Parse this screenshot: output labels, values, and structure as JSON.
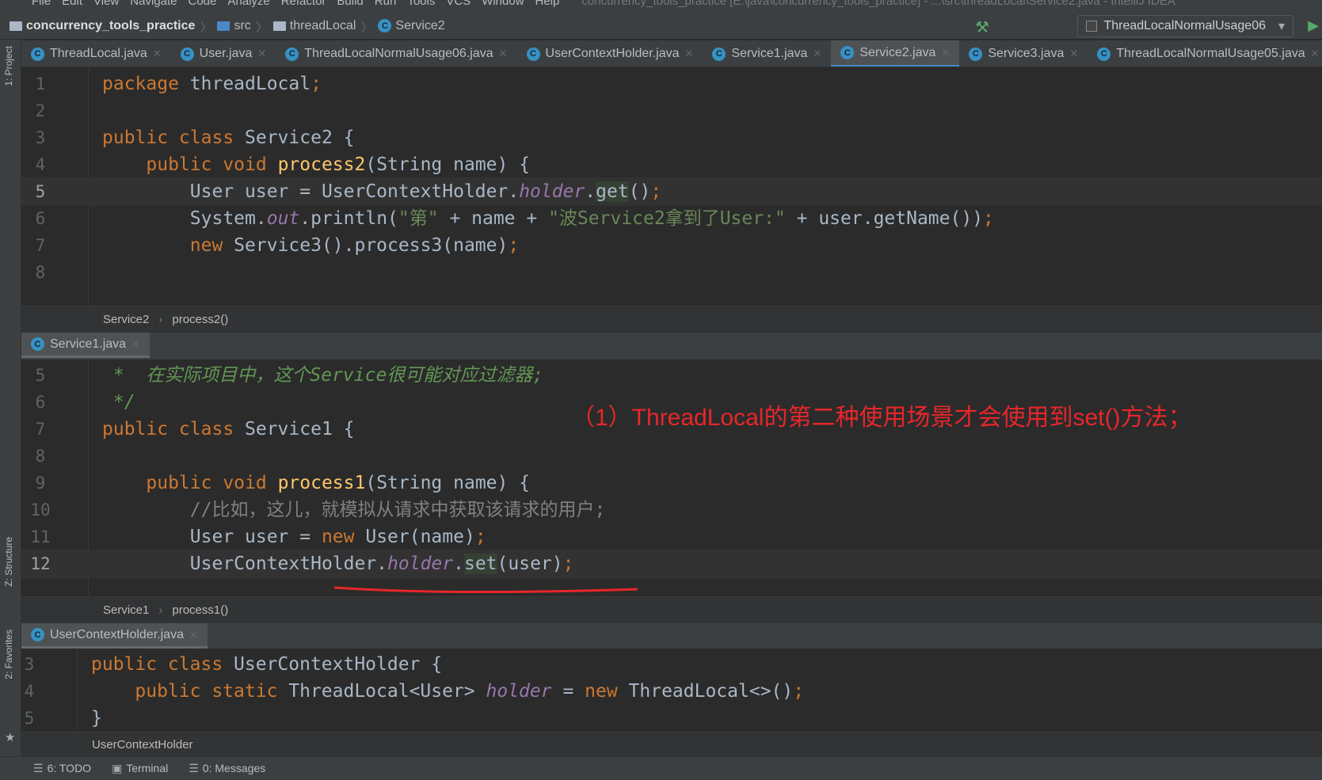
{
  "menu": {
    "items": [
      "File",
      "Edit",
      "View",
      "Navigate",
      "Code",
      "Analyze",
      "Refactor",
      "Build",
      "Run",
      "Tools",
      "VCS",
      "Window",
      "Help"
    ],
    "title": "concurrency_tools_practice [E:\\java\\concurrency_tools_practice] - ...\\src\\threadLocal\\Service2.java - IntelliJ IDEA"
  },
  "breadcrumb": {
    "project": "concurrency_tools_practice",
    "src": "src",
    "package": "threadLocal",
    "file": "Service2"
  },
  "run_config": "ThreadLocalNormalUsage06",
  "side": {
    "project": "1: Project",
    "structure": "Z: Structure",
    "favorites": "2: Favorites"
  },
  "tabs": [
    {
      "label": "ThreadLocal.java"
    },
    {
      "label": "User.java"
    },
    {
      "label": "ThreadLocalNormalUsage06.java"
    },
    {
      "label": "UserContextHolder.java"
    },
    {
      "label": "Service1.java"
    },
    {
      "label": "Service2.java",
      "active": true
    },
    {
      "label": "Service3.java"
    },
    {
      "label": "ThreadLocalNormalUsage05.java"
    }
  ],
  "editor1": {
    "current": 5,
    "lines": [
      {
        "n": "1",
        "t": [
          [
            "package",
            "kw"
          ],
          [
            " threadLocal",
            ""
          ],
          [
            ";",
            "kw"
          ]
        ]
      },
      {
        "n": "2",
        "t": []
      },
      {
        "n": "3",
        "t": [
          [
            "public class",
            "kw"
          ],
          [
            " Service2 {",
            ""
          ]
        ]
      },
      {
        "n": "4",
        "t": [
          [
            "    public void ",
            "kw"
          ],
          [
            "process2",
            "fn"
          ],
          [
            "(String name) {",
            ""
          ]
        ]
      },
      {
        "n": "5",
        "t": [
          [
            "        User user = UserContextHolder.",
            ""
          ],
          [
            "holder",
            "fld"
          ],
          [
            ".",
            ""
          ],
          [
            "get",
            "hl"
          ],
          [
            "()",
            ""
          ],
          [
            ";",
            "kw"
          ]
        ]
      },
      {
        "n": "6",
        "t": [
          [
            "        System.",
            ""
          ],
          [
            "out",
            "fld"
          ],
          [
            ".println(",
            ""
          ],
          [
            "\"第\"",
            "str"
          ],
          [
            " + name + ",
            ""
          ],
          [
            "\"波Service2拿到了User:\"",
            "str"
          ],
          [
            " + user.getName())",
            ""
          ],
          [
            ";",
            "kw"
          ]
        ]
      },
      {
        "n": "7",
        "t": [
          [
            "        new ",
            "kw"
          ],
          [
            "Service3().process3(name)",
            ""
          ],
          [
            ";",
            "kw"
          ]
        ]
      },
      {
        "n": "8",
        "t": []
      }
    ],
    "footer": [
      "Service2",
      "process2()"
    ]
  },
  "split1_tab": "Service1.java",
  "editor2": {
    "current": 12,
    "lines": [
      {
        "n": "5",
        "t": [
          [
            " *  在实际项目中，这个Service很可能对应过滤器;",
            "doc"
          ]
        ]
      },
      {
        "n": "6",
        "t": [
          [
            " */",
            "doc"
          ]
        ]
      },
      {
        "n": "7",
        "t": [
          [
            "public class",
            "kw"
          ],
          [
            " Service1 {",
            ""
          ]
        ]
      },
      {
        "n": "8",
        "t": []
      },
      {
        "n": "9",
        "t": [
          [
            "    public void ",
            "kw"
          ],
          [
            "process1",
            "fn"
          ],
          [
            "(String name) {",
            ""
          ]
        ]
      },
      {
        "n": "10",
        "t": [
          [
            "        //比如，这儿，就模拟从请求中获取该请求的用户;",
            "cm"
          ]
        ]
      },
      {
        "n": "11",
        "t": [
          [
            "        User user = ",
            ""
          ],
          [
            "new",
            "kw"
          ],
          [
            " User(name)",
            ""
          ],
          [
            ";",
            "kw"
          ]
        ]
      },
      {
        "n": "12",
        "t": [
          [
            "        UserContextHolder.",
            ""
          ],
          [
            "holder",
            "fld"
          ],
          [
            ".",
            ""
          ],
          [
            "set",
            "hl"
          ],
          [
            "(user)",
            ""
          ],
          [
            ";",
            "kw"
          ]
        ]
      }
    ],
    "footer": [
      "Service1",
      "process1()"
    ]
  },
  "split2_tab": "UserContextHolder.java",
  "editor3": {
    "current": 0,
    "lines": [
      {
        "n": "3",
        "t": [
          [
            "public class",
            "kw"
          ],
          [
            " UserContextHolder {",
            ""
          ]
        ]
      },
      {
        "n": "4",
        "t": [
          [
            "    public static ",
            "kw"
          ],
          [
            "ThreadLocal<User> ",
            ""
          ],
          [
            "holder",
            "fld"
          ],
          [
            " = ",
            ""
          ],
          [
            "new",
            "kw"
          ],
          [
            " ThreadLocal<>()",
            ""
          ],
          [
            ";",
            "kw"
          ]
        ]
      },
      {
        "n": "5",
        "t": [
          [
            "}",
            ""
          ]
        ]
      }
    ],
    "footer": [
      "UserContextHolder"
    ]
  },
  "annotation": "（1）ThreadLocal的第二种使用场景才会使用到set()方法；",
  "annotation_color": "#e8262a",
  "bottom": {
    "todo": "6: TODO",
    "terminal": "Terminal",
    "messages": "0: Messages"
  }
}
